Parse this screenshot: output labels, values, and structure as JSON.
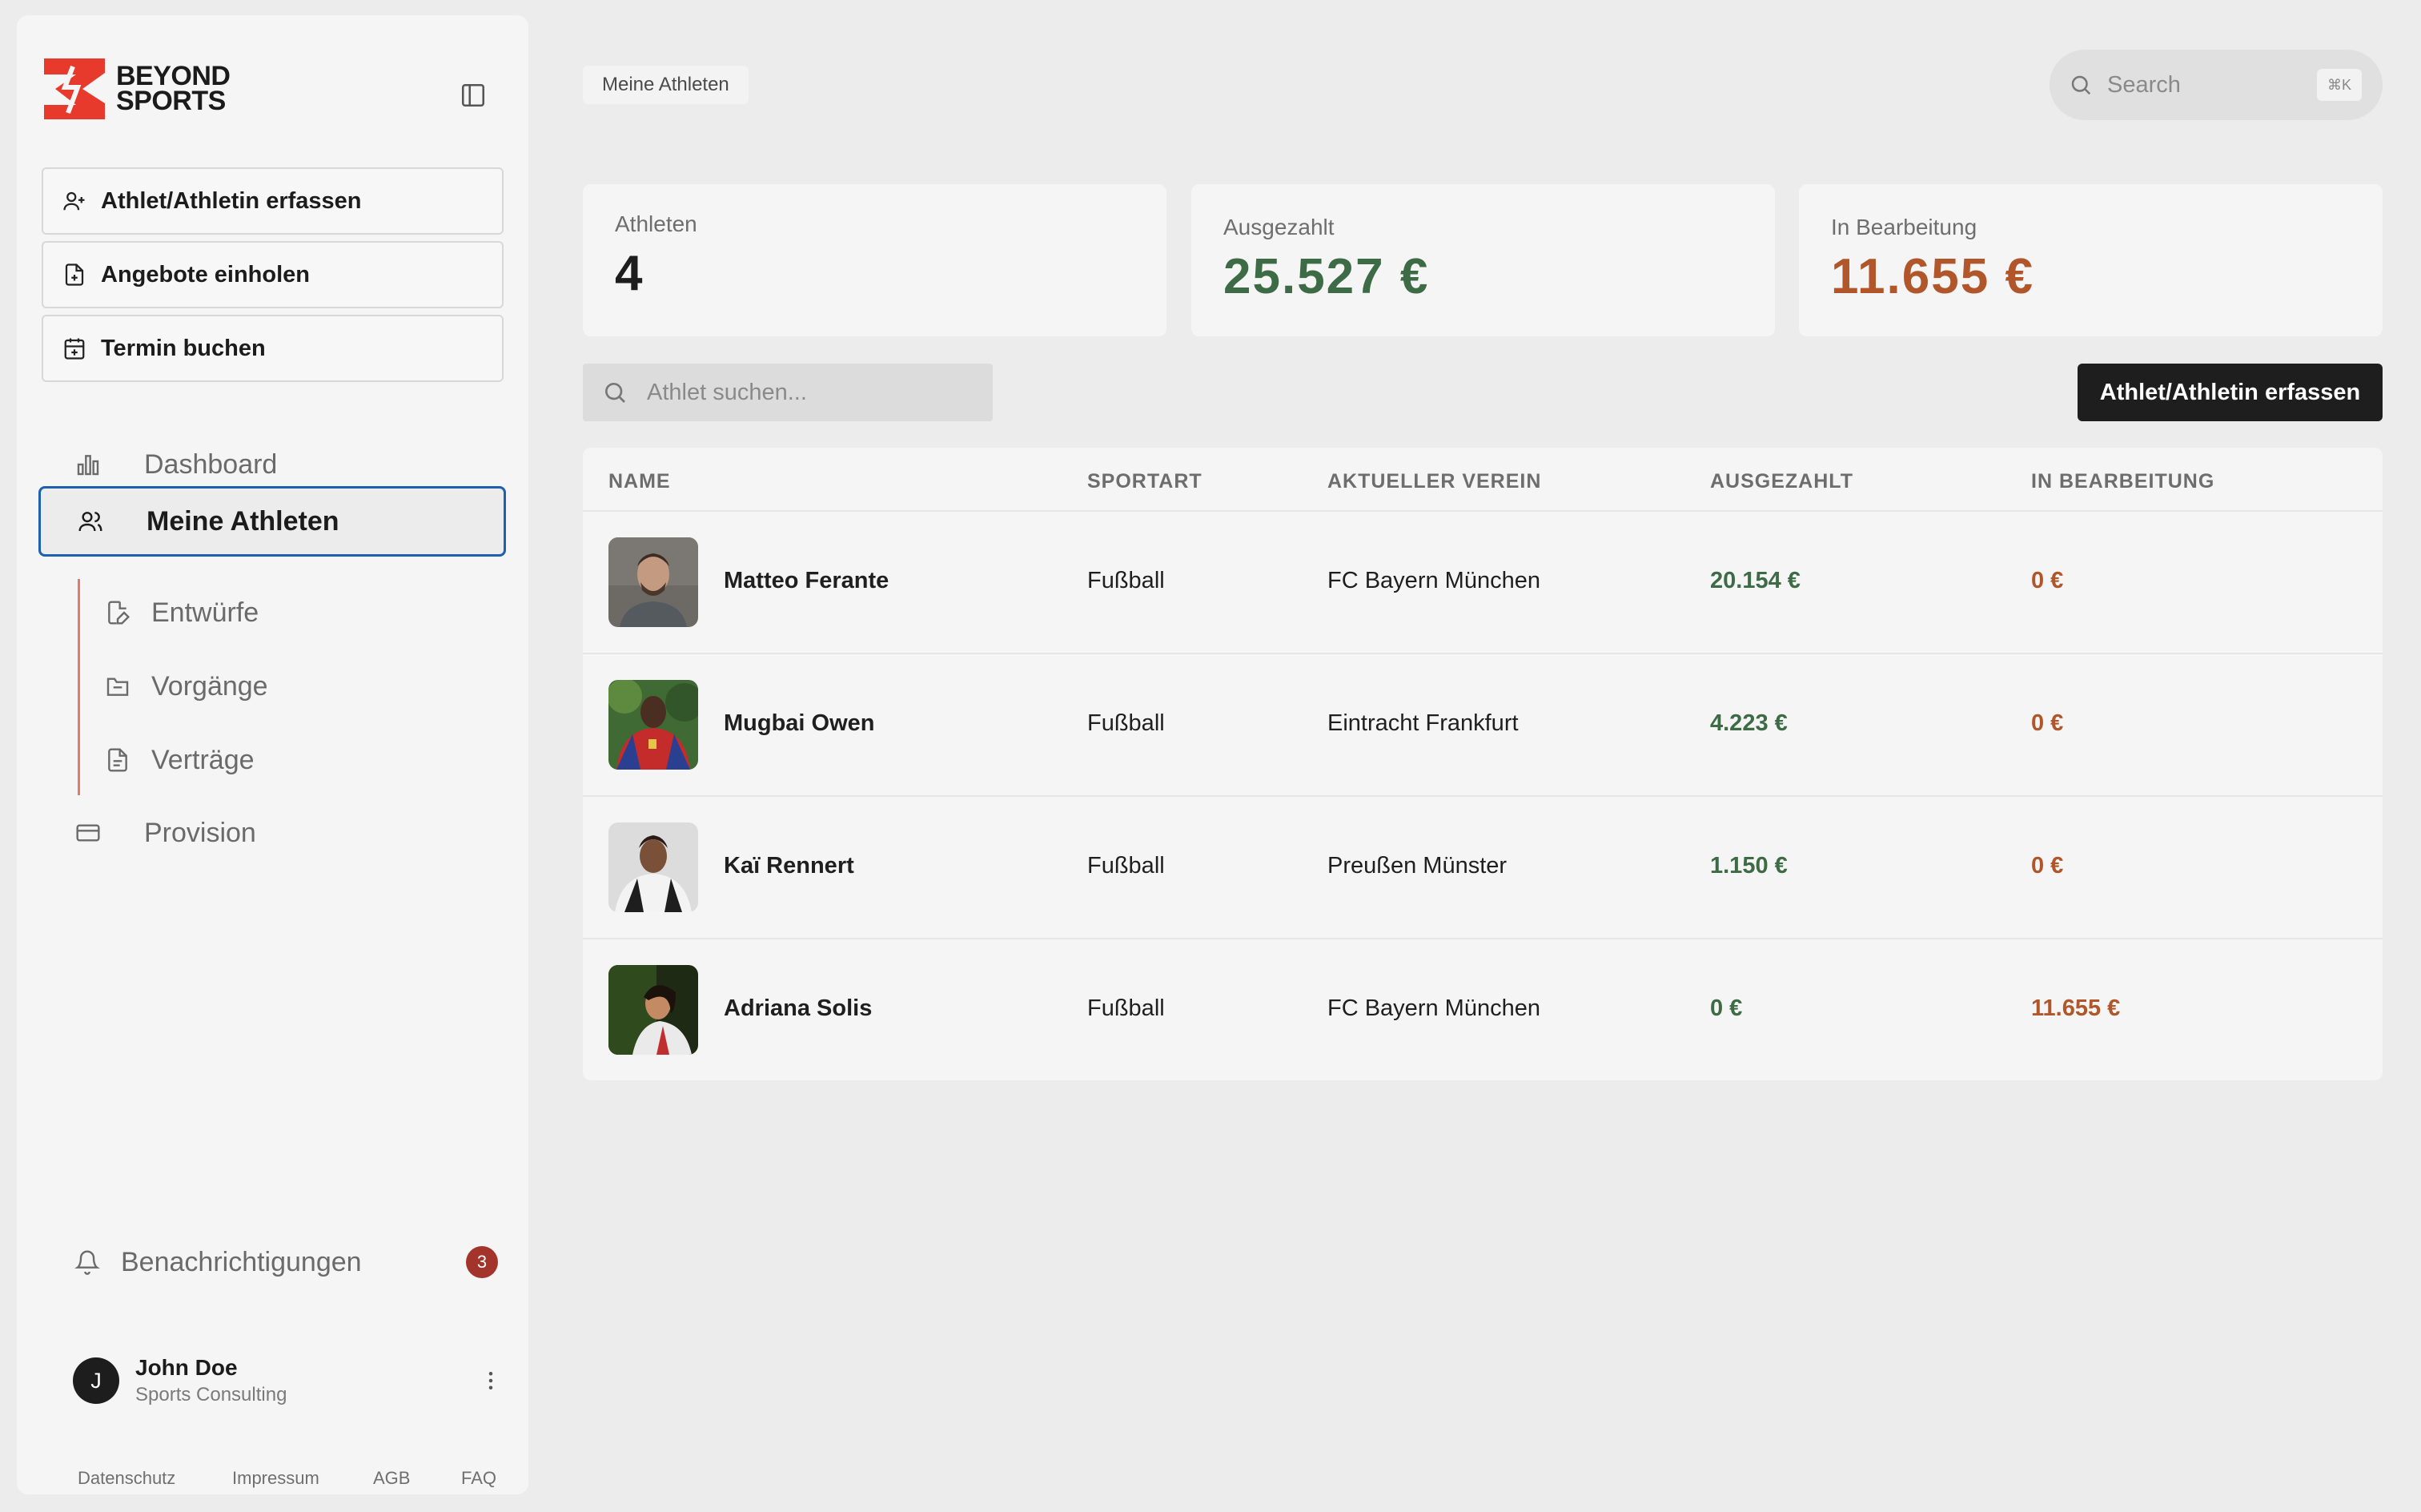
{
  "brand": {
    "line1": "BEYOND",
    "line2": "SPORTS"
  },
  "sidebar": {
    "actions": [
      {
        "label": "Athlet/Athletin erfassen",
        "icon": "user-plus-icon"
      },
      {
        "label": "Angebote einholen",
        "icon": "file-plus-icon"
      },
      {
        "label": "Termin buchen",
        "icon": "calendar-plus-icon"
      }
    ],
    "nav": [
      {
        "label": "Dashboard",
        "icon": "bar-chart-icon"
      },
      {
        "label": "Meine Athleten",
        "icon": "users-icon",
        "active": true
      },
      {
        "label": "Provision",
        "icon": "credit-card-icon"
      }
    ],
    "sub_nav": [
      {
        "label": "Entwürfe",
        "icon": "file-pen-icon"
      },
      {
        "label": "Vorgänge",
        "icon": "folder-icon"
      },
      {
        "label": "Verträge",
        "icon": "file-text-icon"
      }
    ],
    "notifications": {
      "label": "Benachrichtigungen",
      "count": "3"
    },
    "user": {
      "initial": "J",
      "name": "John Doe",
      "role": "Sports Consulting"
    },
    "footer": [
      "Datenschutz",
      "Impressum",
      "AGB",
      "FAQ"
    ]
  },
  "header": {
    "breadcrumb": "Meine Athleten",
    "search_placeholder": "Search",
    "search_shortcut": "⌘K"
  },
  "stats": [
    {
      "label": "Athleten",
      "value": "4",
      "color": "#1d1d1d"
    },
    {
      "label": "Ausgezahlt",
      "value": "25.527 €",
      "color": "#3d6b45"
    },
    {
      "label": "In Bearbeitung",
      "value": "11.655 €",
      "color": "#b0562a"
    }
  ],
  "list": {
    "search_placeholder": "Athlet suchen...",
    "add_button": "Athlet/Athletin erfassen",
    "columns": [
      "NAME",
      "SPORTART",
      "AKTUELLER VEREIN",
      "AUSGEZAHLT",
      "IN BEARBEITUNG"
    ],
    "rows": [
      {
        "name": "Matteo Ferante",
        "sport": "Fußball",
        "club": "FC Bayern München",
        "paid": "20.154 €",
        "pending": "0 €"
      },
      {
        "name": "Mugbai Owen",
        "sport": "Fußball",
        "club": "Eintracht Frankfurt",
        "paid": "4.223 €",
        "pending": "0 €"
      },
      {
        "name": "Kaï Rennert",
        "sport": "Fußball",
        "club": "Preußen Münster",
        "paid": "1.150 €",
        "pending": "0 €"
      },
      {
        "name": "Adriana Solis",
        "sport": "Fußball",
        "club": "FC Bayern München",
        "paid": "0 €",
        "pending": "11.655 €"
      }
    ]
  },
  "colors": {
    "accent": "#1f5fb0",
    "paid": "#3d6b45",
    "pending": "#b0562a",
    "brand_red": "#e8392d",
    "badge": "#a3342b"
  }
}
